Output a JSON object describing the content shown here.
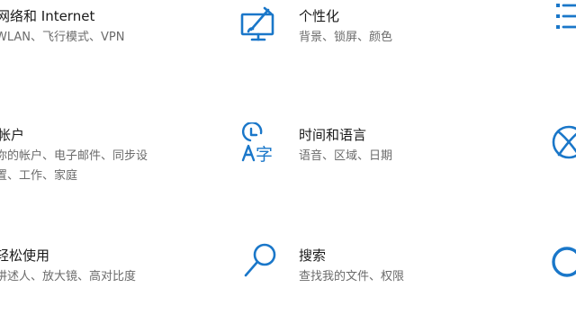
{
  "settings_grid": {
    "accent_color": "#1a77c9",
    "tiles": [
      {
        "id": "network",
        "icon": "globe-icon",
        "title": "网络和 Internet",
        "desc_lines": [
          "WLAN、飞行模式、VPN"
        ]
      },
      {
        "id": "personalization",
        "icon": "paintbrush-monitor-icon",
        "title": "个性化",
        "desc_lines": [
          "背景、锁屏、颜色"
        ]
      },
      {
        "id": "apps",
        "icon": "apps-list-icon",
        "title": "",
        "desc_lines": []
      },
      {
        "id": "accounts",
        "icon": "person-icon",
        "title": "帐户",
        "desc_lines": [
          "你的帐户、电子邮件、同步设",
          "置、工作、家庭"
        ]
      },
      {
        "id": "time-language",
        "icon": "time-language-icon",
        "title": "时间和语言",
        "desc_lines": [
          "语音、区域、日期"
        ]
      },
      {
        "id": "gaming",
        "icon": "xbox-icon",
        "title": "",
        "desc_lines": []
      },
      {
        "id": "ease-of-access",
        "icon": "accessibility-icon",
        "title": "轻松使用",
        "desc_lines": [
          "讲述人、放大镜、高对比度"
        ]
      },
      {
        "id": "search",
        "icon": "magnifier-icon",
        "title": "搜索",
        "desc_lines": [
          "查找我的文件、权限"
        ]
      },
      {
        "id": "cortana",
        "icon": "cortana-ring-icon",
        "title": "",
        "desc_lines": []
      }
    ]
  }
}
